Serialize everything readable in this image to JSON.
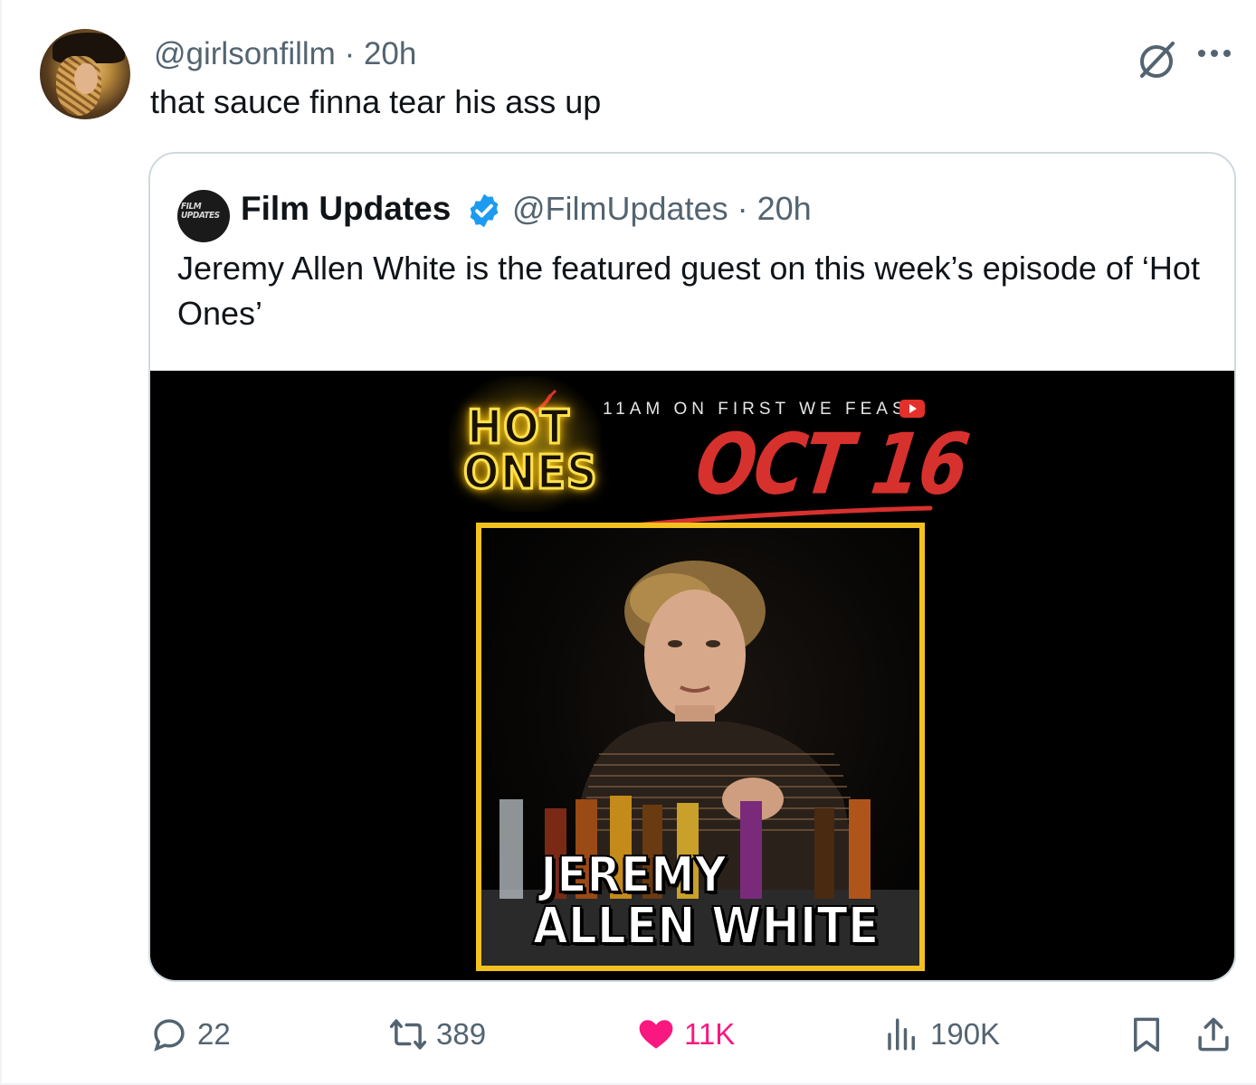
{
  "tweet": {
    "handle": "@girlsonfillm",
    "separator": "·",
    "age": "20h",
    "handle_line": "@girlsonfillm · 20h",
    "text": "that sauce finna tear his ass up"
  },
  "quoted": {
    "name": "Film Updates",
    "handle_line": "@FilmUpdates · 20h",
    "avatar_text": "FILM UPDATES",
    "text": "Jeremy Allen White is the featured guest on this week’s episode of ‘Hot Ones’",
    "media": {
      "logo_line1": "HOT",
      "logo_line2": "ONES",
      "air_time": "11AM ON FIRST WE FEAST",
      "date": "OCT 16",
      "caption_line1": "JEREMY",
      "caption_line2": "ALLEN WHITE"
    }
  },
  "actions": {
    "replies": "22",
    "reposts": "389",
    "likes": "11K",
    "views": "190K"
  },
  "colors": {
    "text_primary": "#0f1419",
    "text_secondary": "#536471",
    "like_pink": "#f91880",
    "verified_blue": "#1d9bf0",
    "hot_ones_yellow": "#f3c21f",
    "date_red": "#d7312e"
  },
  "icons": [
    "grok-icon",
    "more-icon",
    "verified-badge-icon",
    "reply-icon",
    "repost-icon",
    "like-heart-icon",
    "views-icon",
    "bookmark-icon",
    "share-icon",
    "youtube-icon"
  ]
}
